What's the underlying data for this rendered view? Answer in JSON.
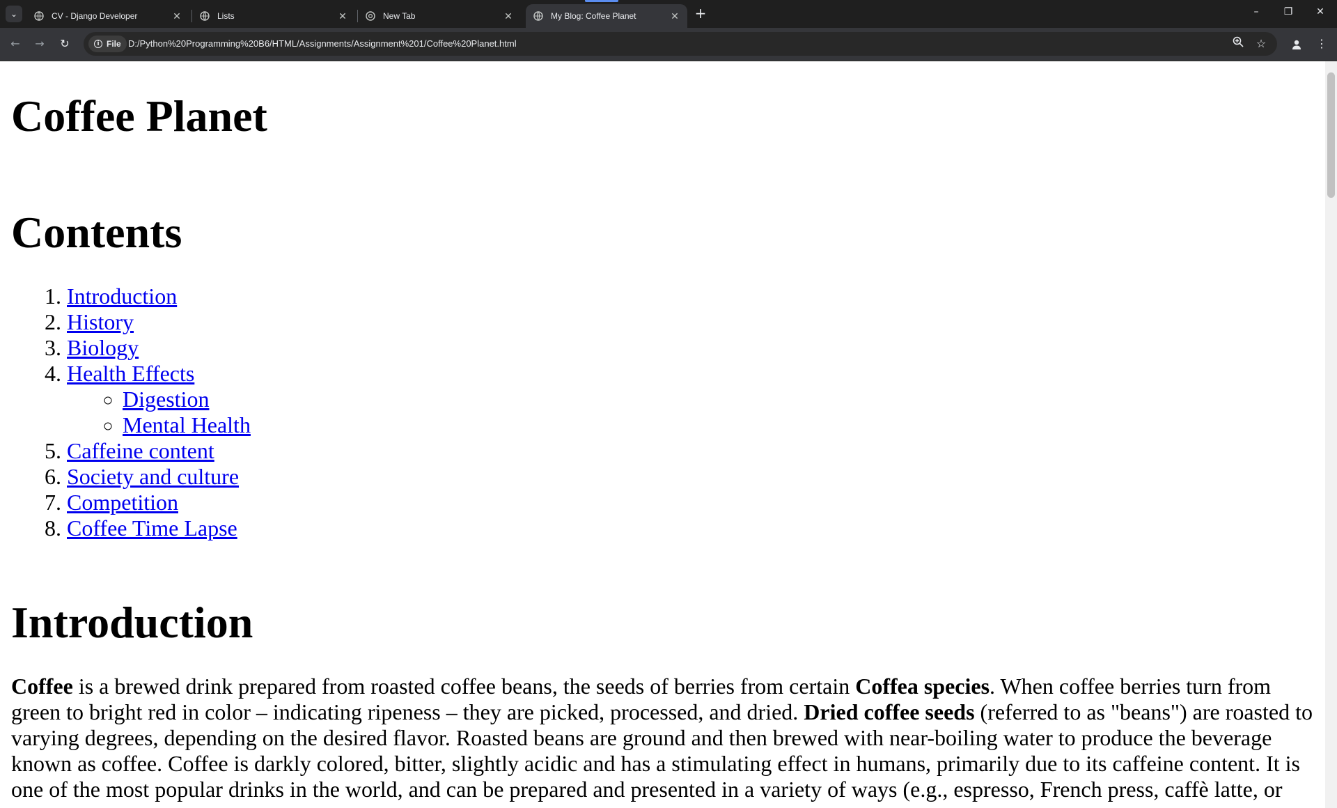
{
  "browser": {
    "tabs": [
      {
        "title": "CV - Django Developer",
        "active": false
      },
      {
        "title": "Lists",
        "active": false
      },
      {
        "title": "New Tab",
        "active": false
      },
      {
        "title": "My Blog: Coffee Planet",
        "active": true
      }
    ],
    "chip_label": "File",
    "url": "D:/Python%20Programming%20B6/HTML/Assignments/Assignment%201/Coffee%20Planet.html",
    "icons": {
      "tab_search": "chevron-down-icon",
      "back": "arrow-left-icon",
      "forward": "arrow-right-icon",
      "reload": "reload-icon",
      "zoom": "zoom-icon",
      "bookmark": "star-icon",
      "profile": "person-icon",
      "menu": "kebab-menu-icon"
    }
  },
  "page": {
    "title": "Coffee Planet",
    "contents_heading": "Contents",
    "toc": [
      {
        "label": "Introduction"
      },
      {
        "label": "History"
      },
      {
        "label": "Biology"
      },
      {
        "label": "Health Effects",
        "children": [
          {
            "label": "Digestion"
          },
          {
            "label": "Mental Health"
          }
        ]
      },
      {
        "label": "Caffeine content"
      },
      {
        "label": "Society and culture"
      },
      {
        "label": "Competition"
      },
      {
        "label": "Coffee Time Lapse"
      }
    ],
    "intro_heading": "Introduction",
    "intro": {
      "b1": "Coffee",
      "t1": " is a brewed drink prepared from roasted coffee beans, the seeds of berries from certain ",
      "b2": "Coffea species",
      "t2": ". When coffee berries turn from green to bright red in color – indicating ripeness – they are picked, processed, and dried. ",
      "b3": "Dried coffee seeds",
      "t3": " (referred to as \"beans\") are roasted to varying degrees, depending on the desired flavor. Roasted beans are ground and then brewed with near-boiling water to produce the beverage known as coffee. Coffee is darkly colored, bitter, slightly acidic and has a stimulating effect in humans, primarily due to its caffeine content. It is one of the most popular drinks in the world, and can be prepared and presented in a variety of ways (e.g., espresso, French press, caffè latte, or"
    }
  }
}
